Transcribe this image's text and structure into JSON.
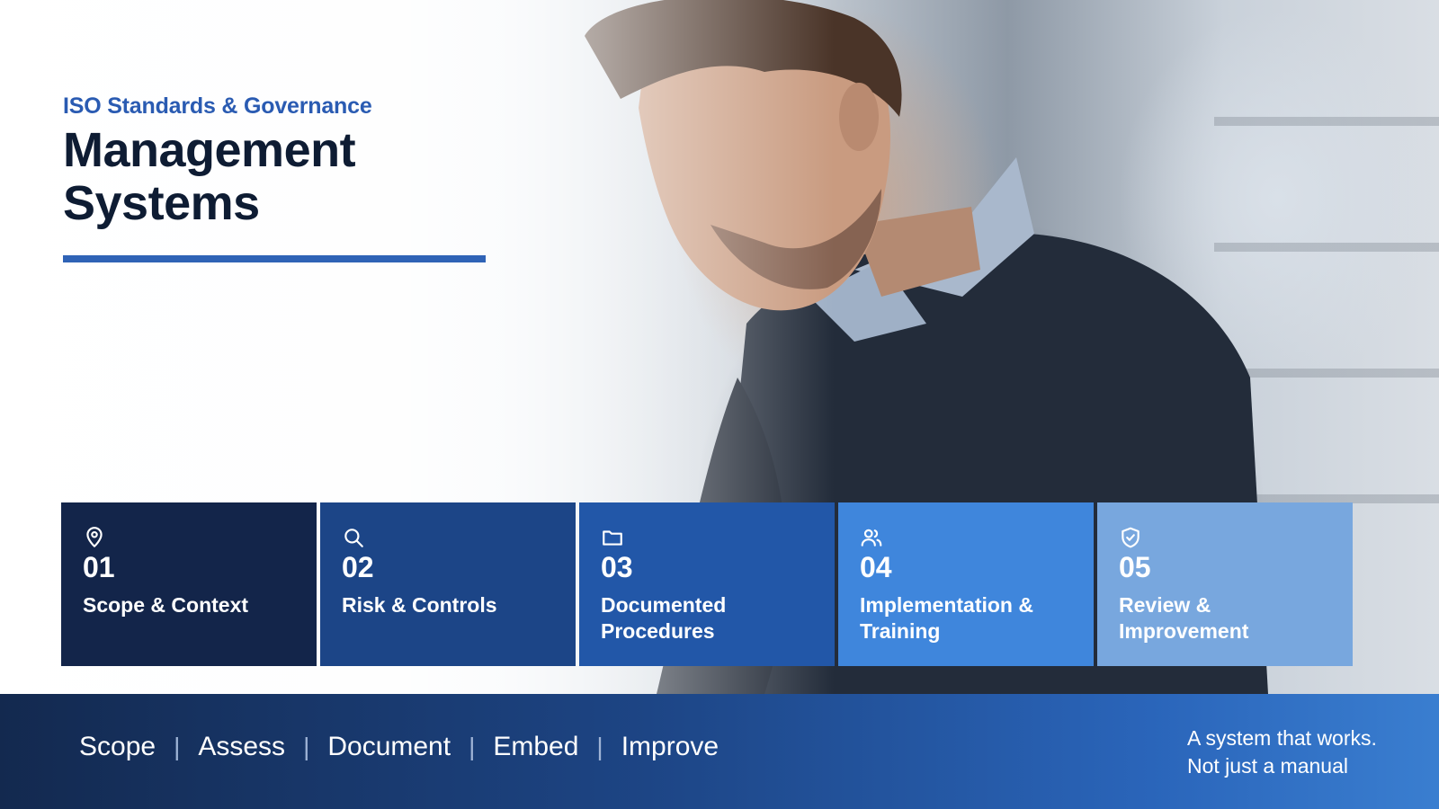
{
  "header": {
    "eyebrow": "ISO Standards & Governance",
    "title_line1": "Management",
    "title_line2": "Systems"
  },
  "colors": {
    "accent": "#2f63b6",
    "title": "#0e1c33",
    "card1": "#13254a",
    "card2": "#1c4587",
    "card3": "#2257a8",
    "card4": "#3f86dc",
    "card5": "#78a7de"
  },
  "cards": [
    {
      "icon": "map-pin-icon",
      "number": "01",
      "label": "Scope & Context"
    },
    {
      "icon": "search-icon",
      "number": "02",
      "label": "Risk & Controls"
    },
    {
      "icon": "folder-icon",
      "number": "03",
      "label": "Documented Procedures"
    },
    {
      "icon": "users-icon",
      "number": "04",
      "label": "Implementation & Training"
    },
    {
      "icon": "shield-check-icon",
      "number": "05",
      "label": "Review & Improvement"
    }
  ],
  "footer": {
    "steps": [
      "Scope",
      "Assess",
      "Document",
      "Embed",
      "Improve"
    ],
    "separator": "|",
    "tagline_line1": "A system that works.",
    "tagline_line2": "Not just a manual"
  }
}
